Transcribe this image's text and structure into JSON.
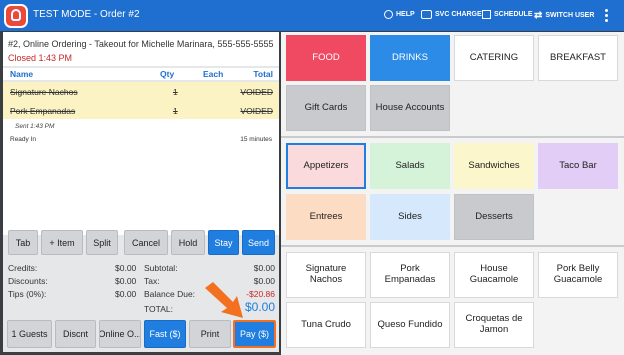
{
  "header": {
    "title": "TEST MODE - Order #2",
    "help": "HELP",
    "svc_charge": "SVC CHARGE",
    "schedule": "SCHEDULE",
    "switch_user": "SWITCH USER"
  },
  "order": {
    "description": "#2, Online Ordering - Takeout for Michelle Marinara, 555-555-5555",
    "status": "Closed 1:43 PM",
    "columns": {
      "name": "Name",
      "qty": "Qty",
      "each": "Each",
      "total": "Total"
    },
    "items": [
      {
        "name": "Signature Nachos",
        "qty": "1",
        "total": "VOIDED"
      },
      {
        "name": "Pork Empanadas",
        "qty": "1",
        "total": "VOIDED"
      }
    ],
    "sent": "Sent 1:43 PM",
    "ready_label": "Ready In",
    "ready_value": "15 minutes"
  },
  "actions": {
    "tab": "Tab",
    "item": "+ Item",
    "split": "Split",
    "cancel": "Cancel",
    "hold": "Hold",
    "stay": "Stay",
    "send": "Send"
  },
  "totals": {
    "credits_label": "Credits:",
    "credits": "$0.00",
    "discounts_label": "Discounts:",
    "discounts": "$0.00",
    "tips_label": "Tips (0%):",
    "tips": "$0.00",
    "subtotal_label": "Subtotal:",
    "subtotal": "$0.00",
    "tax_label": "Tax:",
    "tax": "$0.00",
    "balance_label": "Balance Due:",
    "balance": "-$20.86",
    "total_label": "TOTAL:",
    "total": "$0.00"
  },
  "footer": {
    "guests": "1 Guests",
    "discount": "Discnt",
    "online": "Online O...",
    "fast": "Fast ($)",
    "print": "Print",
    "pay": "Pay ($)"
  },
  "menu": {
    "categories": [
      "FOOD",
      "DRINKS",
      "CATERING",
      "BREAKFAST",
      "Gift Cards",
      "House Accounts"
    ],
    "subcategories": [
      "Appetizers",
      "Salads",
      "Sandwiches",
      "Taco Bar",
      "Entrees",
      "Sides",
      "Desserts"
    ],
    "items": [
      "Signature Nachos",
      "Pork Empanadas",
      "House Guacamole",
      "Pork Belly Guacamole",
      "Tuna Crudo",
      "Queso Fundido",
      "Croquetas de Jamon"
    ]
  },
  "colors": {
    "accent": "#1f7ee0",
    "food": "#f04a63",
    "voided_row": "#fbf3c3",
    "negative": "#c62828",
    "arrow": "#f37021"
  }
}
